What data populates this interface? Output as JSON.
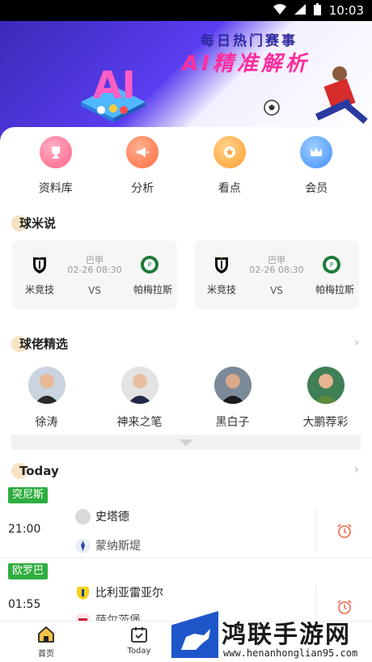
{
  "status_bar": {
    "time": "10:03"
  },
  "banner": {
    "line1": "每日热门赛事",
    "line2": "AI精准解析",
    "big_text": "AI"
  },
  "quick_menu": [
    {
      "label": "资料库",
      "icon": "trophy-icon",
      "color": "#ff6b8a"
    },
    {
      "label": "分析",
      "icon": "megaphone-icon",
      "color": "#ff7a50"
    },
    {
      "label": "看点",
      "icon": "medal-icon",
      "color": "#ffa63d"
    },
    {
      "label": "会员",
      "icon": "crown-icon",
      "color": "#4d9bff"
    }
  ],
  "qiumi": {
    "title": "球米说",
    "matches": [
      {
        "league": "巴甲",
        "time": "02-26 08:30",
        "home": "米竞技",
        "away": "帕梅拉斯",
        "vs": "VS"
      },
      {
        "league": "巴甲",
        "time": "02-26 08:30",
        "home": "米竞技",
        "away": "帕梅拉斯",
        "vs": "VS"
      }
    ]
  },
  "experts": {
    "title": "球佬精选",
    "items": [
      {
        "name": "徐涛"
      },
      {
        "name": "神来之笔"
      },
      {
        "name": "黑白子"
      },
      {
        "name": "大鹏荐彩"
      }
    ]
  },
  "today": {
    "title": "Today",
    "matches": [
      {
        "league": "突尼斯",
        "time": "21:00",
        "home": "史塔德",
        "away": "蒙纳斯堤"
      },
      {
        "league": "欧罗巴",
        "time": "01:55",
        "home": "比利亚雷亚尔",
        "away": "萨尔茨堡"
      }
    ]
  },
  "tabbar": {
    "home": "首页",
    "today": "Today"
  },
  "watermark": {
    "brand": "鸿联手游网",
    "url": "www.henanhonglian95.com"
  }
}
